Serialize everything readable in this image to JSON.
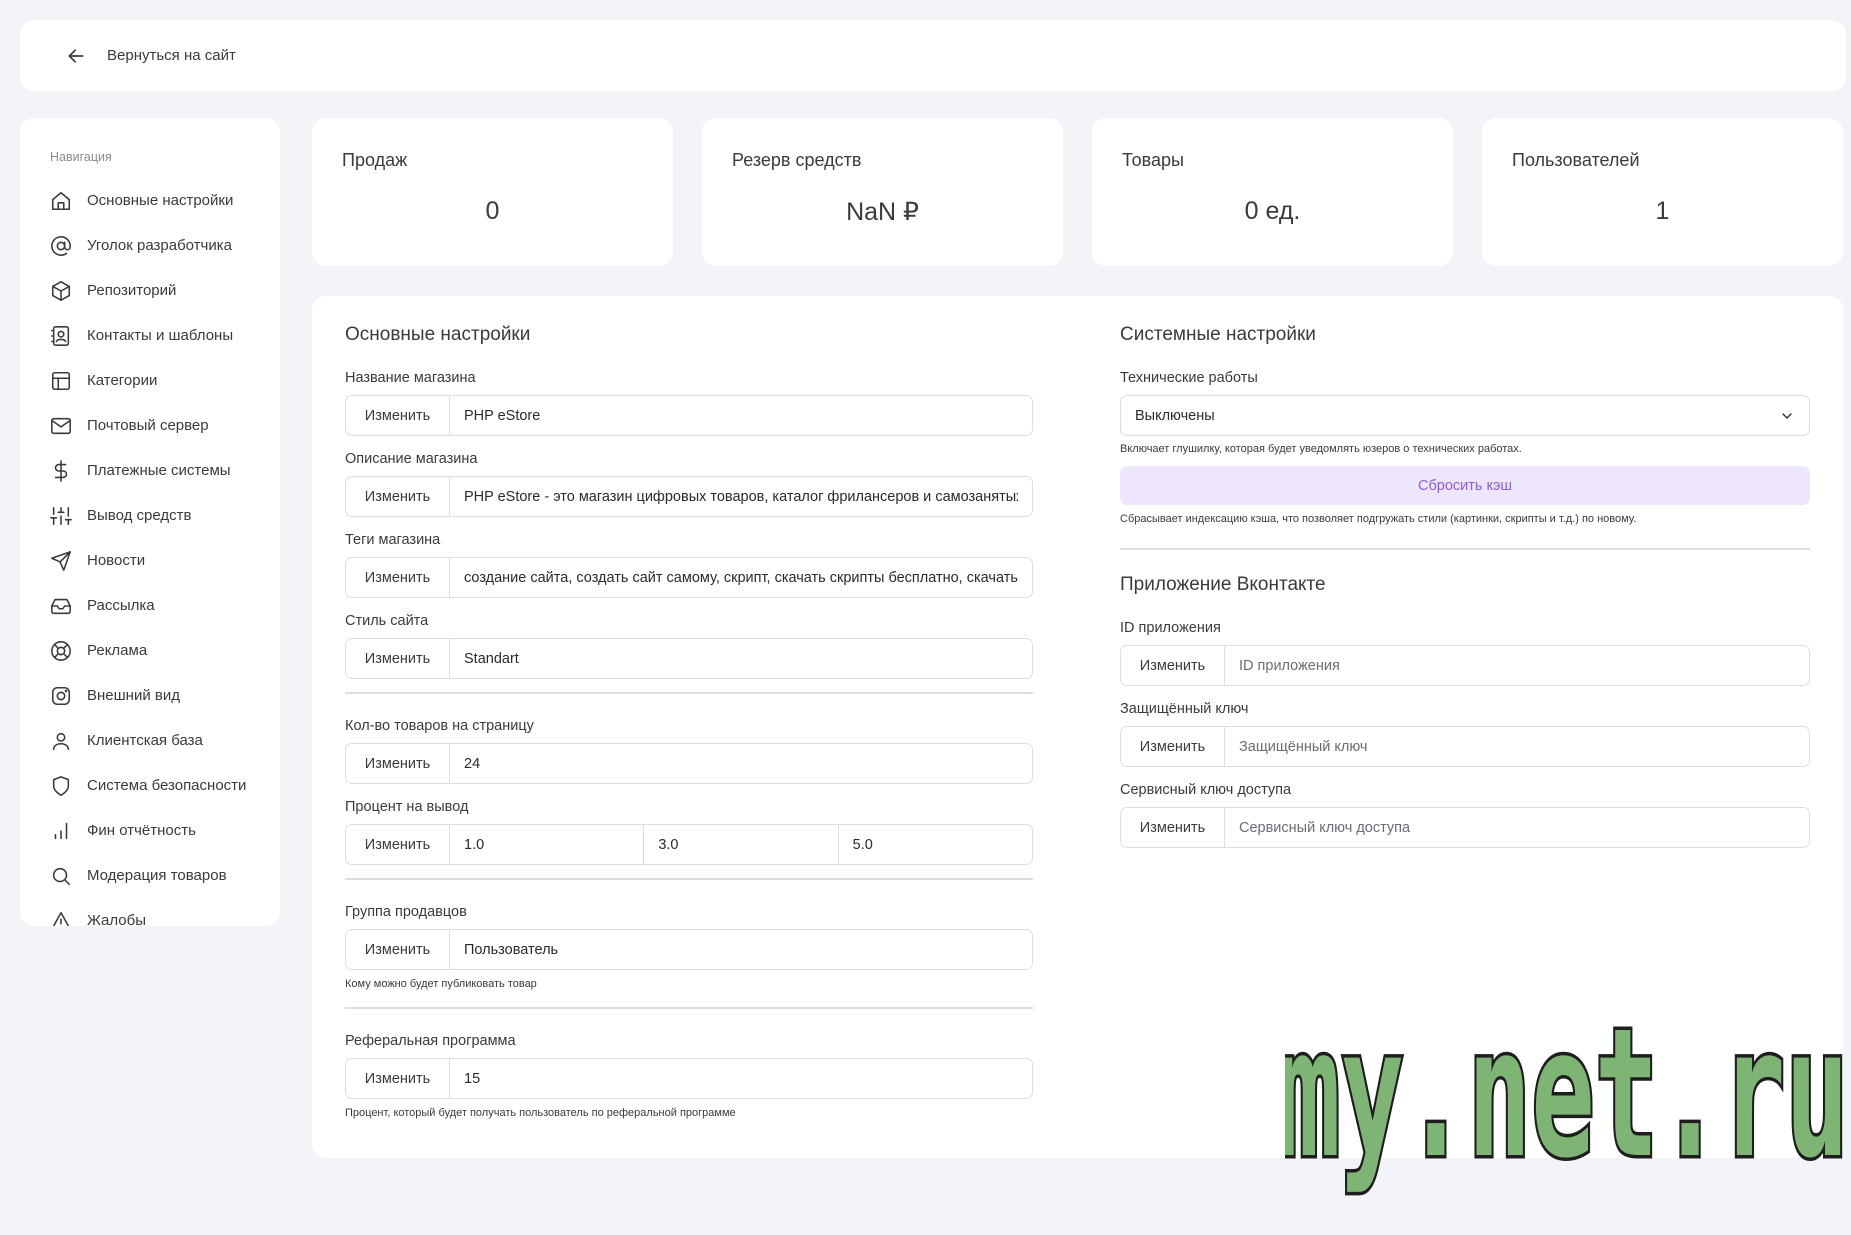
{
  "topbar": {
    "back_label": "Вернуться на сайт"
  },
  "sidebar": {
    "title": "Навигация",
    "items": [
      {
        "label": "Основные настройки",
        "icon": "home-icon"
      },
      {
        "label": "Уголок разработчика",
        "icon": "at-icon"
      },
      {
        "label": "Репозиторий",
        "icon": "box-icon"
      },
      {
        "label": "Контакты и шаблоны",
        "icon": "contact-icon"
      },
      {
        "label": "Категории",
        "icon": "layout-icon"
      },
      {
        "label": "Почтовый сервер",
        "icon": "mail-icon"
      },
      {
        "label": "Платежные системы",
        "icon": "dollar-icon"
      },
      {
        "label": "Вывод средств",
        "icon": "sliders-icon"
      },
      {
        "label": "Новости",
        "icon": "send-icon"
      },
      {
        "label": "Рассылка",
        "icon": "inbox-icon"
      },
      {
        "label": "Реклама",
        "icon": "lifebuoy-icon"
      },
      {
        "label": "Внешний вид",
        "icon": "instagram-icon"
      },
      {
        "label": "Клиентская база",
        "icon": "user-icon"
      },
      {
        "label": "Система безопасности",
        "icon": "shield-icon"
      },
      {
        "label": "Фин отчётность",
        "icon": "bar-chart-icon"
      },
      {
        "label": "Модерация товаров",
        "icon": "search-icon"
      },
      {
        "label": "Жалобы",
        "icon": "alert-triangle-icon"
      }
    ]
  },
  "stats": {
    "sales": {
      "title": "Продаж",
      "value": "0"
    },
    "reserve": {
      "title": "Резерв средств",
      "value": "NaN ₽"
    },
    "goods": {
      "title": "Товары",
      "value": "0 ед."
    },
    "users": {
      "title": "Пользователей",
      "value": "1"
    }
  },
  "basic": {
    "title": "Основные настройки",
    "button_label": "Изменить",
    "shop_name": {
      "label": "Название магазина",
      "value": "PHP eStore"
    },
    "shop_desc": {
      "label": "Описание магазина",
      "value": "PHP eStore - это магазин цифровых товаров, каталог фрилансеров и самозанятых п"
    },
    "shop_tags": {
      "label": "Теги магазина",
      "value": "создание сайта, создать сайт самому, скрипт, скачать скрипты бесплатно, скачать скр"
    },
    "site_style": {
      "label": "Стиль сайта",
      "value": "Standart"
    },
    "per_page": {
      "label": "Кол-во товаров на страницу",
      "value": "24"
    },
    "withdraw_percent": {
      "label": "Процент на вывод",
      "values": [
        "1.0",
        "3.0",
        "5.0"
      ]
    },
    "seller_group": {
      "label": "Группа продавцов",
      "value": "Пользователь",
      "hint": "Кому можно будет публиковать товар"
    },
    "referral": {
      "label": "Реферальная программа",
      "value": "15",
      "hint": "Процент, который будет получать пользователь по реферальной программе"
    }
  },
  "system": {
    "title": "Системные настройки",
    "maintenance": {
      "label": "Технические работы",
      "selected": "Выключены",
      "hint": "Включает глушилку, которая будет уведомлять юзеров о технических работах."
    },
    "cache": {
      "button": "Сбросить кэш",
      "hint": "Сбрасывает индексацию кэша, что позволяет подгружать стили (картинки, скрипты и т.д.) по новому."
    }
  },
  "vk": {
    "title": "Приложение Вконтакте",
    "button_label": "Изменить",
    "app_id": {
      "label": "ID приложения",
      "placeholder": "ID приложения"
    },
    "secret_key": {
      "label": "Защищённый ключ",
      "placeholder": "Защищённый ключ"
    },
    "service_key": {
      "label": "Сервисный ключ доступа",
      "placeholder": "Сервисный ключ доступа"
    }
  },
  "watermark": {
    "text": "my.net.ru"
  },
  "colors": {
    "accent": "#8c5ae6",
    "accent_bg": "#ede6fd",
    "watermark_fill": "#7fb574",
    "watermark_stroke": "#1e1e1e"
  }
}
